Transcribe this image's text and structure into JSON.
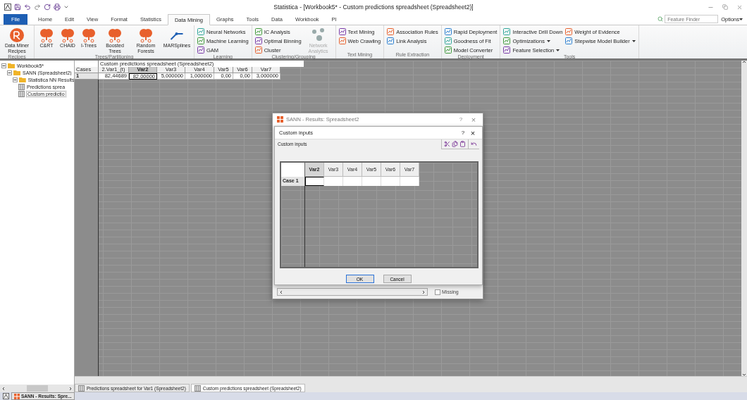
{
  "window": {
    "title": "Statistica - [Workbook5* - Custom predictions spreadsheet (Spreadsheet2)]"
  },
  "feature_finder": {
    "placeholder": "Feature Finder"
  },
  "options_menu": "Options",
  "ribbon_tabs": [
    {
      "label": "File",
      "kind": "file",
      "selected": false
    },
    {
      "label": "Home",
      "kind": "tab",
      "selected": false
    },
    {
      "label": "Edit",
      "kind": "tab",
      "selected": false
    },
    {
      "label": "View",
      "kind": "tab",
      "selected": false
    },
    {
      "label": "Format",
      "kind": "tab",
      "selected": false
    },
    {
      "label": "Statistics",
      "kind": "tab",
      "selected": false
    },
    {
      "label": "Data Mining",
      "kind": "tab",
      "selected": true
    },
    {
      "label": "Graphs",
      "kind": "tab",
      "selected": false
    },
    {
      "label": "Tools",
      "kind": "tab",
      "selected": false
    },
    {
      "label": "Data",
      "kind": "tab",
      "selected": false
    },
    {
      "label": "Workbook",
      "kind": "tab",
      "selected": false
    },
    {
      "label": "PI",
      "kind": "tab",
      "selected": false
    }
  ],
  "ribbon_groups": [
    {
      "label": "Recipes",
      "items": [
        {
          "label": "Data Miner Recipes",
          "kind": "large",
          "disabled": false
        }
      ]
    },
    {
      "label": "Trees/Partitioning",
      "items": [
        {
          "label": "C&RT",
          "kind": "large",
          "disabled": false
        },
        {
          "label": "CHAID",
          "kind": "large",
          "disabled": false
        },
        {
          "label": "I-Trees",
          "kind": "large",
          "disabled": false
        },
        {
          "label": "Boosted Trees",
          "kind": "large",
          "disabled": false
        },
        {
          "label": "Random Forests",
          "kind": "large",
          "disabled": false
        },
        {
          "label": "MARSplines",
          "kind": "large",
          "disabled": false
        }
      ]
    },
    {
      "label": "Learning",
      "items": [
        {
          "label": "Neural Networks",
          "kind": "small",
          "dropdown": false
        },
        {
          "label": "Machine Learning",
          "kind": "small",
          "dropdown": false
        },
        {
          "label": "GAM",
          "kind": "small",
          "dropdown": false
        }
      ]
    },
    {
      "label": "Clustering/Grouping",
      "items": [
        {
          "label": "IC Analysis",
          "kind": "small",
          "dropdown": false
        },
        {
          "label": "Optimal Binning",
          "kind": "small",
          "dropdown": false
        },
        {
          "label": "Cluster",
          "kind": "small",
          "dropdown": false
        },
        {
          "label": "Network Analytics",
          "kind": "large",
          "disabled": true
        }
      ]
    },
    {
      "label": "Text Mining",
      "items": [
        {
          "label": "Text Mining",
          "kind": "small",
          "dropdown": false
        },
        {
          "label": "Web Crawling",
          "kind": "small",
          "dropdown": false
        }
      ]
    },
    {
      "label": "Rule Extraction",
      "items": [
        {
          "label": "Association Rules",
          "kind": "small",
          "dropdown": false
        },
        {
          "label": "Link Analysis",
          "kind": "small",
          "dropdown": false
        }
      ]
    },
    {
      "label": "Deployment",
      "items": [
        {
          "label": "Rapid Deployment",
          "kind": "small",
          "dropdown": false
        },
        {
          "label": "Goodness of Fit",
          "kind": "small",
          "dropdown": false
        },
        {
          "label": "Model Converter",
          "kind": "small",
          "dropdown": false
        }
      ]
    },
    {
      "label": "Tools",
      "items": [
        {
          "label": "Interactive Drill Down",
          "kind": "small",
          "dropdown": false
        },
        {
          "label": "Optimizations",
          "kind": "small",
          "dropdown": true
        },
        {
          "label": "Feature Selection",
          "kind": "small",
          "dropdown": true
        },
        {
          "label": "Weight of Evidence",
          "kind": "small",
          "dropdown": false
        },
        {
          "label": "Stepwise Model Builder",
          "kind": "small",
          "dropdown": true
        }
      ]
    }
  ],
  "tree": [
    {
      "label": "Workbook5*",
      "kind": "folder",
      "expanded": true,
      "selected": false,
      "children": [
        {
          "label": "SANN (Spreadsheet2)",
          "kind": "folder",
          "expanded": true,
          "selected": false,
          "children": [
            {
              "label": "Statistica NN Results",
              "kind": "folder",
              "expanded": true,
              "selected": false,
              "children": [
                {
                  "label": "Predictions sprea",
                  "kind": "sheet",
                  "selected": false
                },
                {
                  "label": "Custom predictio",
                  "kind": "sheet",
                  "selected": true
                }
              ]
            }
          ]
        }
      ]
    }
  ],
  "sheet": {
    "title": "Custom predictions spreadsheet (Spreadsheet2)",
    "corner": "Cases",
    "columns": [
      {
        "label": "2.Var1_(t)",
        "selected": false
      },
      {
        "label": "Var2",
        "selected": true
      },
      {
        "label": "Var3",
        "selected": false
      },
      {
        "label": "Var4",
        "selected": false
      },
      {
        "label": "Var5",
        "selected": false
      },
      {
        "label": "Var6",
        "selected": false
      },
      {
        "label": "Var7",
        "selected": false
      }
    ],
    "rows": [
      {
        "label": "1",
        "cells": [
          "82,44689",
          "82,00000",
          "5,000000",
          "1,000000",
          "0,00",
          "0,00",
          "3,000000"
        ]
      }
    ]
  },
  "results_window": {
    "title": "SANN - Results: Spreadsheet2",
    "help": "?",
    "close": "×",
    "missing": {
      "label": "Missing",
      "checked": false
    }
  },
  "dialog": {
    "title": "Custom inputs",
    "help": "?",
    "close": "×",
    "caption": "Custom inputs",
    "columns": [
      {
        "label": "Var2",
        "selected": true
      },
      {
        "label": "Var3",
        "selected": false
      },
      {
        "label": "Var4",
        "selected": false
      },
      {
        "label": "Var5",
        "selected": false
      },
      {
        "label": "Var6",
        "selected": false
      },
      {
        "label": "Var7",
        "selected": false
      }
    ],
    "rows": [
      {
        "label": "Case 1"
      }
    ],
    "buttons": [
      {
        "label": "OK",
        "kind": "default"
      },
      {
        "label": "Cancel",
        "kind": "normal"
      }
    ]
  },
  "doc_tabs": [
    {
      "label": "Predictions spreadsheet for Var1 (Spreadsheet2)",
      "selected": false
    },
    {
      "label": "Custom predictions spreadsheet (Spreadsheet2)",
      "selected": true
    }
  ],
  "taskbar": [
    {
      "label": "SANN - Results: Spre..."
    }
  ]
}
